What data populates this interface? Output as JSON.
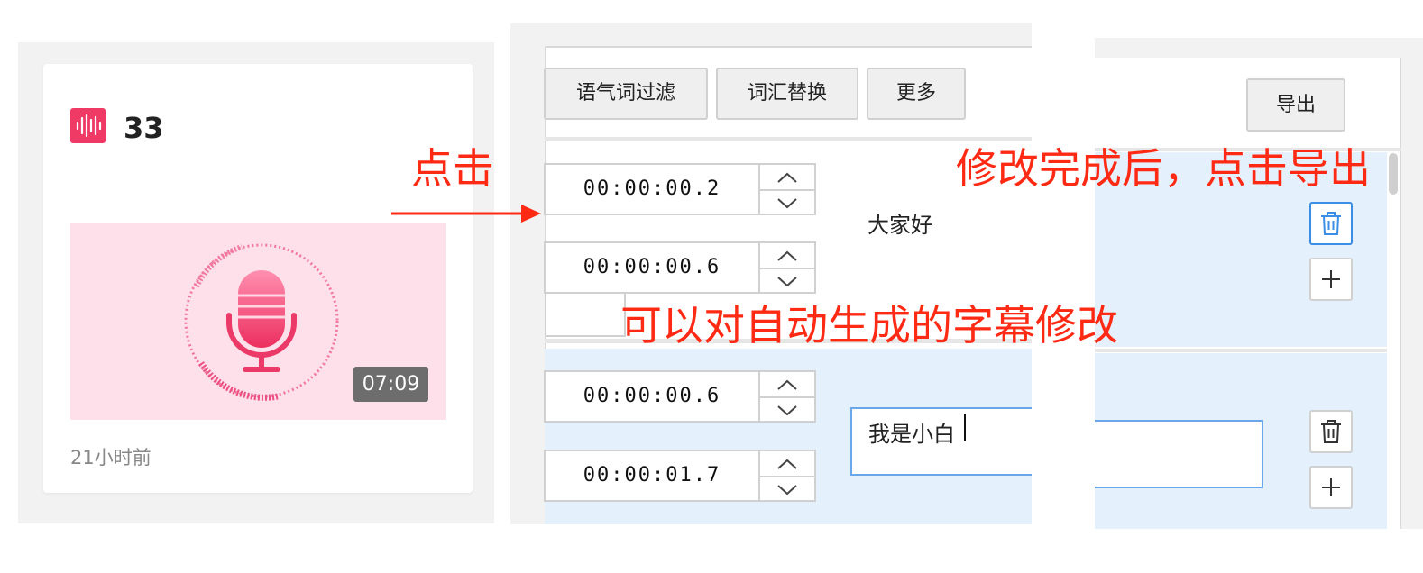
{
  "card": {
    "title": "33",
    "duration": "07:09",
    "time_ago": "21小时前",
    "accent_color": "#ef3a66",
    "icon": "audio-wave-icon",
    "thumbnail_icon": "microphone-icon"
  },
  "toolbar": {
    "filter_label": "语气词过滤",
    "replace_label": "词汇替换",
    "more_label": "更多",
    "export_label": "导出"
  },
  "subtitles": [
    {
      "start": "00:00:00.2",
      "end": "00:00:00.6",
      "text": "大家好"
    },
    {
      "start": "00:00:00.6",
      "end": "00:00:01.7",
      "text": "我是小白"
    }
  ],
  "annotations": {
    "click": "点击",
    "edit_hint": "可以对自动生成的字幕修改",
    "export_hint": "修改完成后，点击导出",
    "color": "#ff2a14"
  },
  "icons": {
    "delete": "trash-icon",
    "add": "plus-icon",
    "up": "chevron-up-icon",
    "down": "chevron-down-icon"
  }
}
